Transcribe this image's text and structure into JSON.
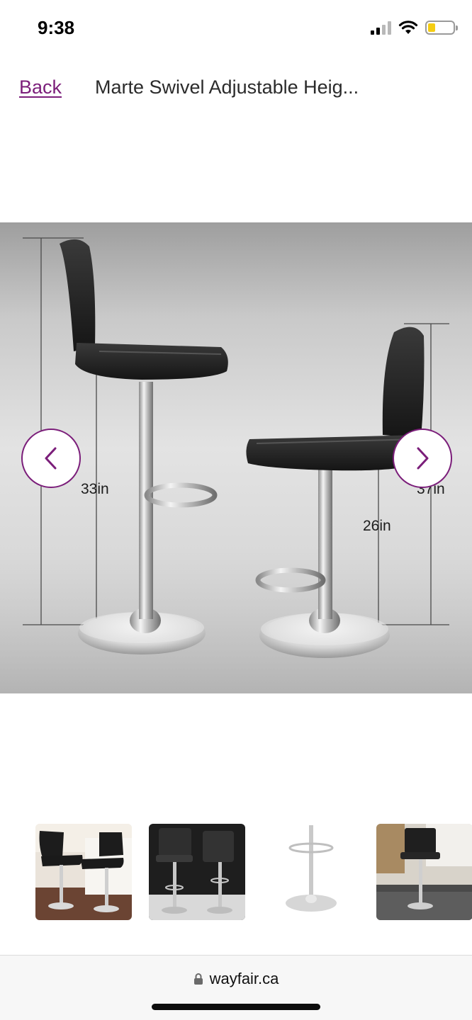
{
  "status_bar": {
    "time": "9:38",
    "icons": [
      "signal-icon",
      "wifi-icon",
      "battery-icon"
    ]
  },
  "header": {
    "back_label": "Back",
    "title": "Marte Swivel Adjustable Heig..."
  },
  "product_image": {
    "dimension_labels": {
      "left_height": "33in",
      "seat_height": "26in",
      "right_height": "37in"
    }
  },
  "carousel": {
    "prev_icon": "chevron-left-icon",
    "next_icon": "chevron-right-icon"
  },
  "thumbnails": [
    {
      "id": "thumb-1"
    },
    {
      "id": "thumb-2"
    },
    {
      "id": "thumb-3"
    },
    {
      "id": "thumb-4"
    }
  ],
  "browser": {
    "url": "wayfair.ca",
    "lock_icon": "lock-icon"
  },
  "colors": {
    "accent": "#7b1e7a",
    "battery": "#f5cd13"
  }
}
